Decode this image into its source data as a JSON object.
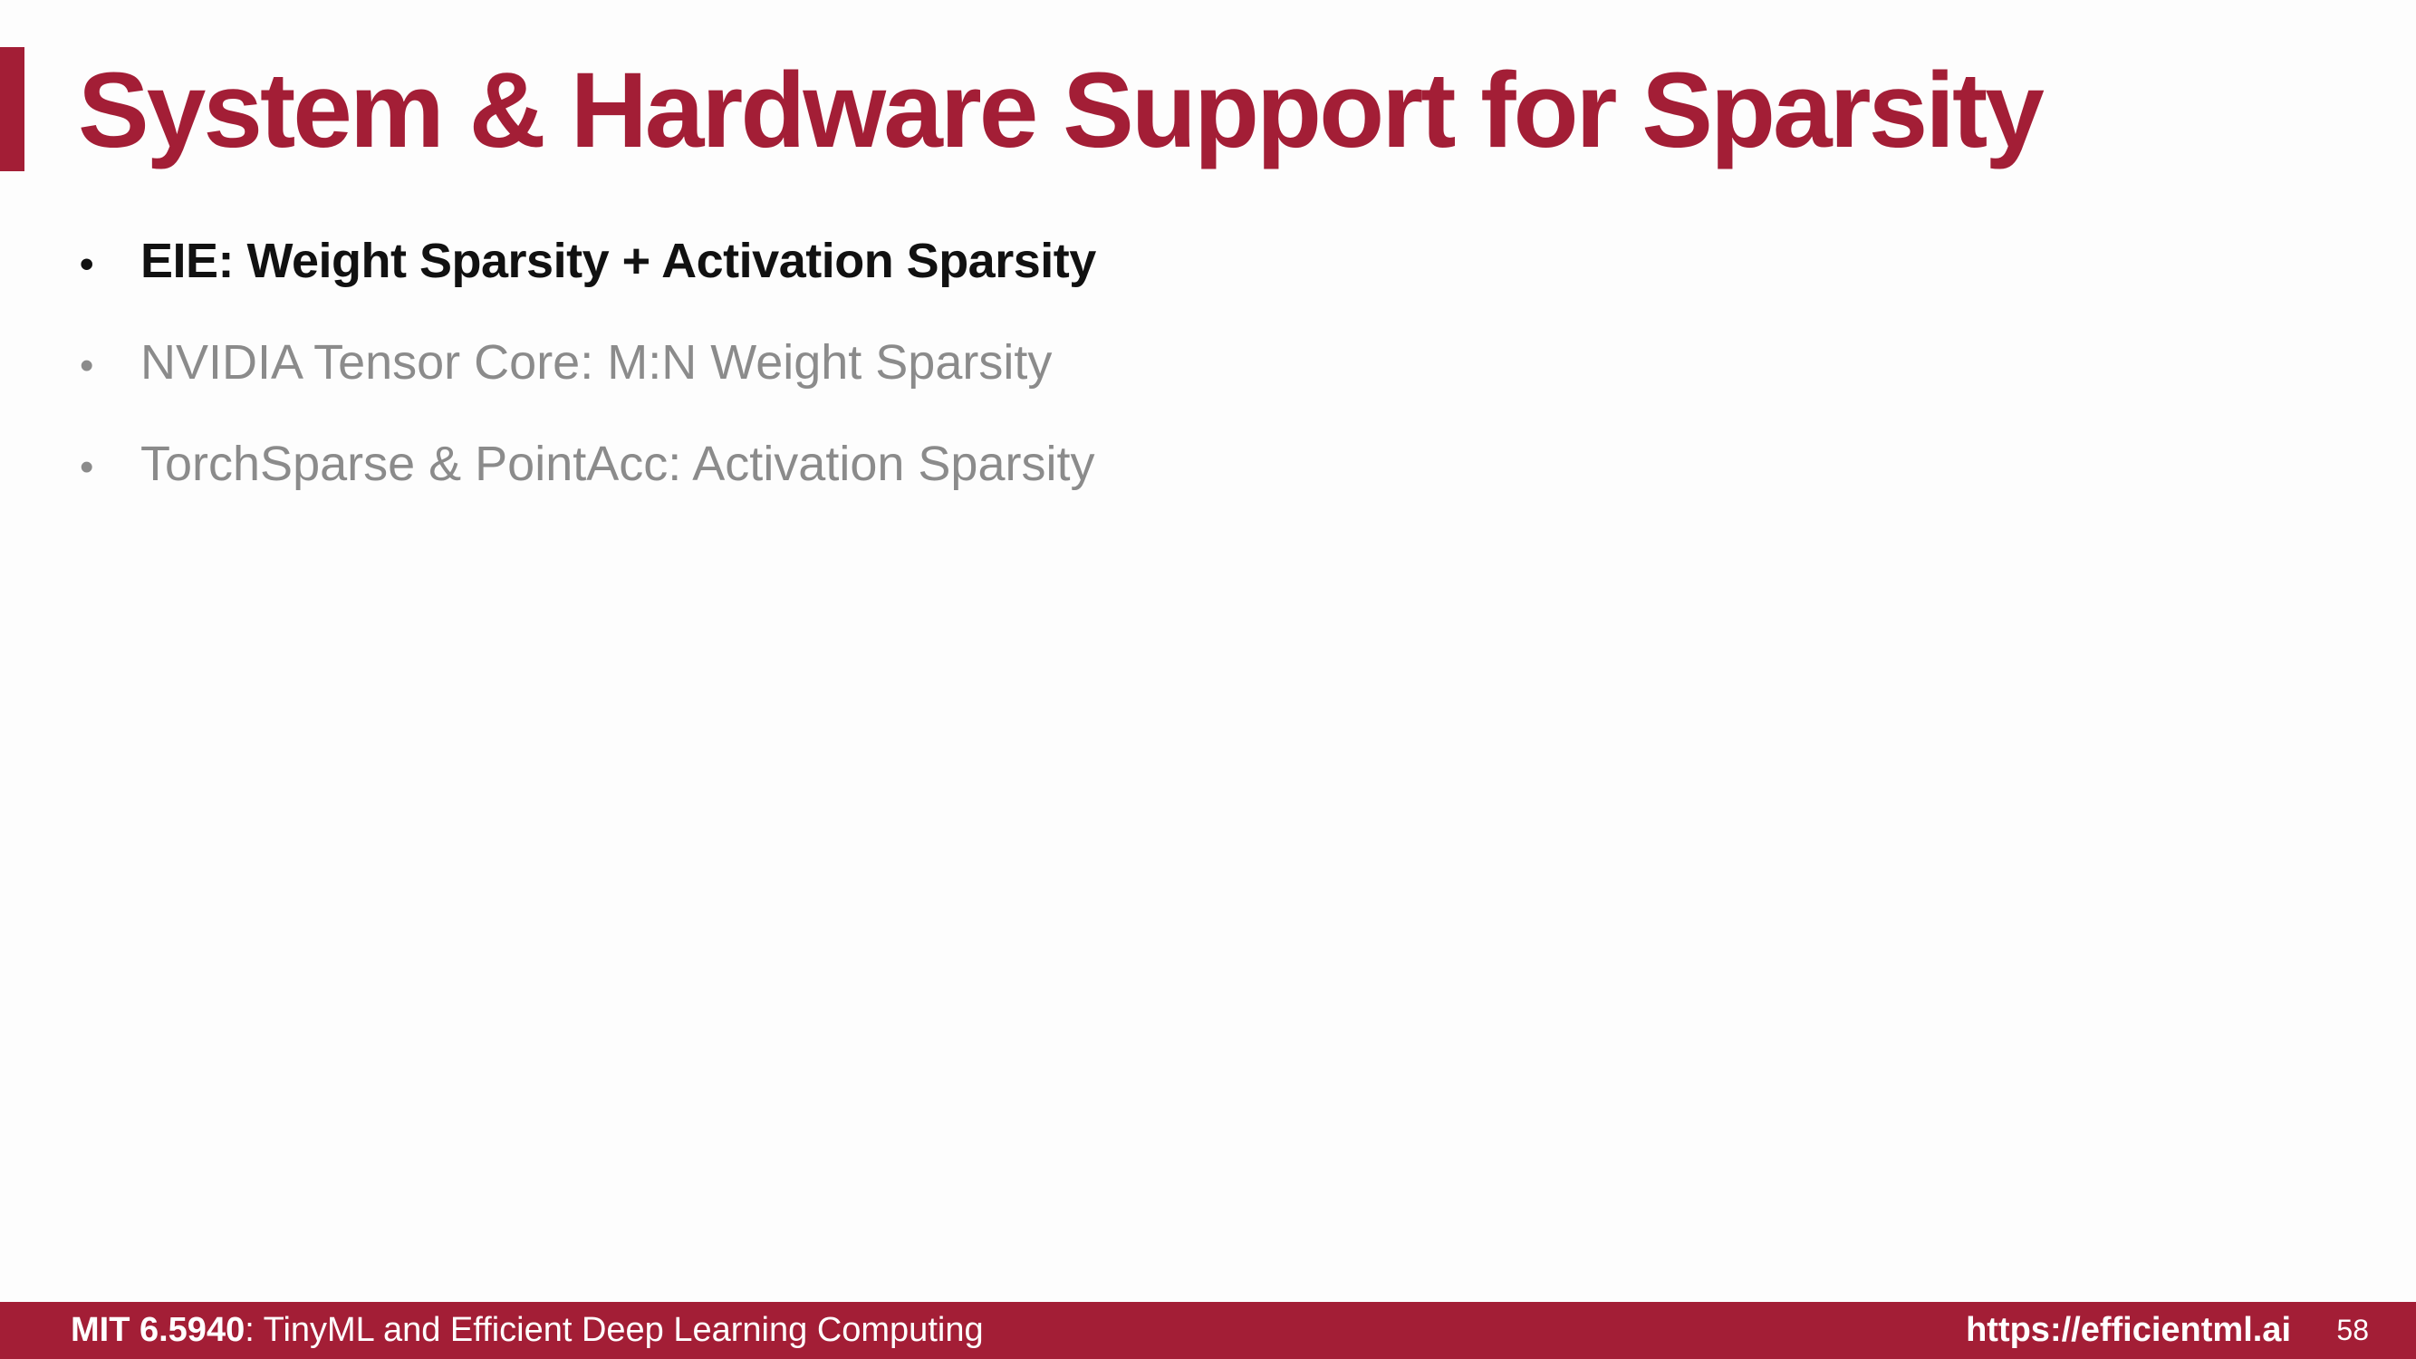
{
  "slide": {
    "title": "System & Hardware Support for Sparsity",
    "bullets": [
      {
        "text": "EIE: Weight Sparsity + Activation Sparsity",
        "state": "active"
      },
      {
        "text": "NVIDIA Tensor Core: M:N Weight Sparsity",
        "state": "inactive"
      },
      {
        "text": "TorchSparse & PointAcc: Activation Sparsity",
        "state": "inactive"
      }
    ],
    "bullet_marker": "•"
  },
  "footer": {
    "course_code": "MIT 6.5940",
    "course_title": ": TinyML and Efficient Deep Learning Computing",
    "url": "https://efficientml.ai",
    "page_number": "58"
  },
  "colors": {
    "brand": "#a31e36",
    "active_text": "#111111",
    "inactive_text": "#8b8b8b",
    "background": "#fdfdfd"
  }
}
